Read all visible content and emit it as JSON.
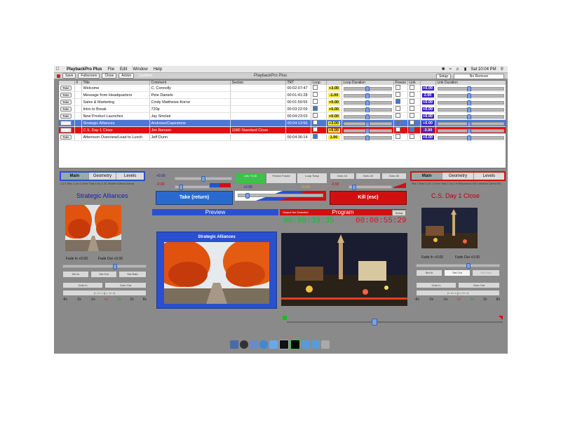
{
  "menubar": {
    "app": "PlaybackPro Plus",
    "menus": [
      "File",
      "Edit",
      "Window",
      "Help"
    ],
    "clock": "Sat 10:04 PM"
  },
  "toolbar": {
    "save": "Save",
    "fullscreen": "Fullscreen",
    "close": "Close",
    "action": "Action",
    "untitled": "Untitled",
    "window_title": "PlaybackPro Plus",
    "setup": "Setup",
    "select": "No Remove"
  },
  "cues": {
    "headers": [
      "",
      "#",
      "Title",
      "Comment",
      "Section",
      "TRT",
      "Loop",
      "",
      "Loop Duration",
      "Freeze",
      "Link",
      "",
      "Link Duration"
    ],
    "take_label": "Take",
    "rows": [
      {
        "title": "Welcome",
        "comment": "C. Connolly",
        "section": "",
        "trt": "00:02:07:47",
        "loop": false,
        "vol": "+3.00",
        "freeze": false,
        "link": false,
        "v2": "+0.00",
        "style": ""
      },
      {
        "title": "Message from Headquarters",
        "comment": "Pete Daniels",
        "section": "",
        "trt": "00:01:41:28",
        "loop": false,
        "vol": "-1.00",
        "freeze": false,
        "link": false,
        "v2": "2.00",
        "style": ""
      },
      {
        "title": "Sales & Marketing",
        "comment": "Cindy Matthews-Korne",
        "section": "",
        "trt": "00:01:59:55",
        "loop": false,
        "vol": "+0.00",
        "freeze": true,
        "link": false,
        "v2": "+0.00",
        "style": ""
      },
      {
        "title": "Intro to Break",
        "comment": "720p",
        "section": "",
        "trt": "00:03:22:09",
        "loop": true,
        "vol": "+0.00",
        "freeze": false,
        "link": false,
        "v2": "+0.00",
        "style": ""
      },
      {
        "title": "New Product Launches",
        "comment": "Jay Sinclair",
        "section": "",
        "trt": "00:04:23:03",
        "loop": false,
        "vol": "+0.00",
        "freeze": false,
        "link": false,
        "v2": "+0.00",
        "style": ""
      },
      {
        "title": "Strategic Alliances",
        "comment": "Andrews/Capestone",
        "section": "",
        "trt": "00:04:13:56",
        "loop": false,
        "vol": "+3.00",
        "freeze": true,
        "link": false,
        "v2": "+0.00",
        "style": "sel1"
      },
      {
        "title": "C.S. Day 1 Close",
        "comment": "Jim Benson",
        "section": "1080 Standard Close",
        "trt": "",
        "loop": false,
        "vol": "+0.00",
        "freeze": false,
        "link": true,
        "v2": "-3.00",
        "style": "sel2"
      },
      {
        "title": "Afternoon Overview/Lead to Lunch",
        "comment": "Jeff Dunn",
        "section": "",
        "trt": "00:04:36:14",
        "loop": true,
        "vol": "1.00",
        "freeze": false,
        "link": false,
        "v2": "+0.00",
        "style": ""
      }
    ]
  },
  "left_panel": {
    "tabs": [
      "Main",
      "Geometry",
      "Levels"
    ],
    "info": "Lo 1 Rec 1 Ov 1 Over Twit 1 Ov 1 3C Motion Gallery Imma",
    "clip_name": "Strategic Alliances",
    "fade_in": "Fade In  +0.00",
    "fade_out": "Fade Out  +0.00",
    "set_in": "Set In",
    "set_out": "Set Out",
    "set_rate": "Set Rate",
    "goto_in": "Goto In",
    "goto_out": "Goto Out",
    "speeds": [
      "-8x",
      "-2x",
      "-1x",
      "<>",
      "1x",
      "2x",
      "8x"
    ]
  },
  "center": {
    "level_a": "+0.00",
    "level_b": "-0.00",
    "take_return": "Take (return)",
    "preview": "Preview",
    "preview_clip": "Strategic Alliances",
    "fx_buttons": [
      "Link +0.00",
      "Freeze Frame",
      "Loop Tiany"
    ],
    "fx_value_blue": "+3.00",
    "fx_value_yellow": "+0.00",
    "goto_buttons": [
      "Goto 10",
      "Goto 20",
      "Goto 30"
    ],
    "goto_level": "-0.50",
    "kill_esc": "Kill (esc)",
    "output_status": "Output Not Detected",
    "program": "Program",
    "setup": "Setup",
    "tc_preview": "00:00:39:35",
    "tc_program": "00:00:55:29"
  },
  "right_panel": {
    "tabs": [
      "Main",
      "Geometry",
      "Levels"
    ],
    "info": "Pks 1 Rec 1 Ov 1 Over Twit 1 Ov 1 9 Resources HD Lebanon Demo Fin",
    "clip_name": "C.S. Day 1 Close",
    "fade_in": "Fade In  +0.00",
    "fade_out": "Fade Out  +0.00",
    "set_in": "Set In",
    "set_out": "Set Out",
    "set_rate": "Set Rate",
    "goto_in": "Goto In",
    "goto_out": "Goto Out",
    "speeds": [
      "-8x",
      "-2x",
      "-1x",
      "<>",
      "1x",
      "2x",
      "8x"
    ]
  },
  "colors": {
    "accent_blue": "#2a4fd0",
    "program_red": "#d01010",
    "timecode_green": "#10c020",
    "timecode_red": "#e01010",
    "selection_blue": "#4a78d6"
  }
}
